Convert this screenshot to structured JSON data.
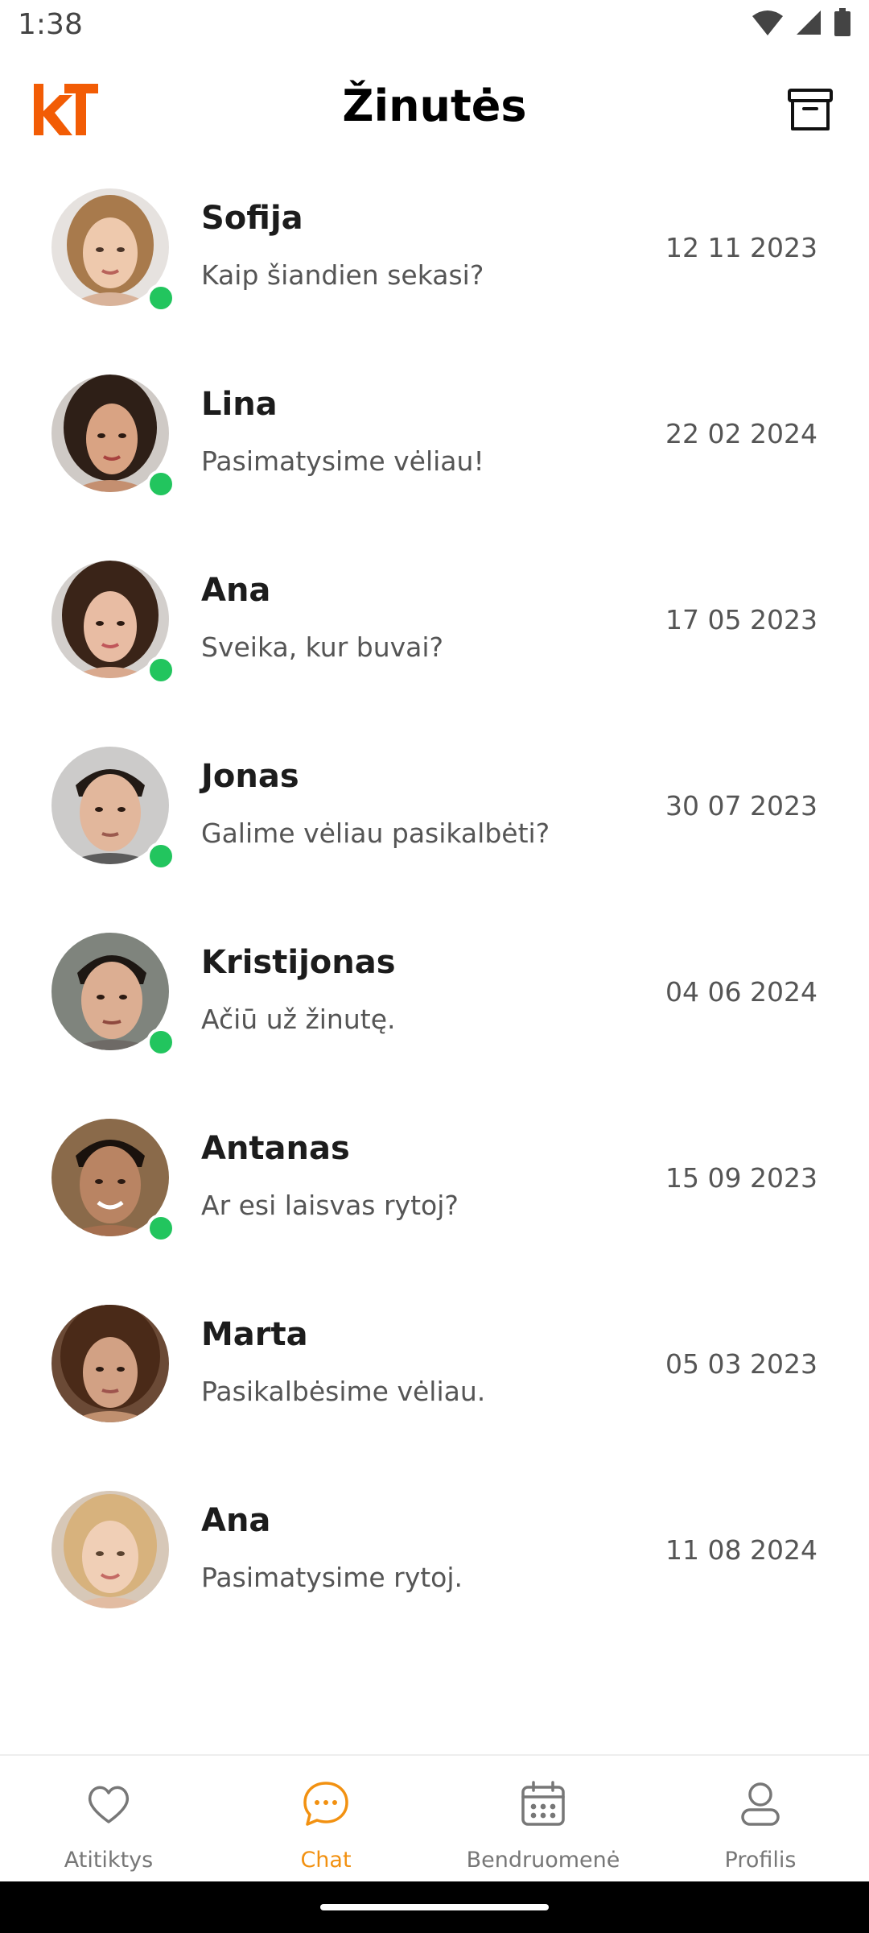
{
  "status_bar": {
    "time": "1:38"
  },
  "header": {
    "title": "Žinutės",
    "logo_text": "kT"
  },
  "conversations": [
    {
      "name": "Sofija",
      "preview": "Kaip šiandien sekasi?",
      "date": "12 11 2023",
      "online": true
    },
    {
      "name": "Lina",
      "preview": "Pasimatysime vėliau!",
      "date": "22 02 2024",
      "online": true
    },
    {
      "name": "Ana",
      "preview": "Sveika, kur buvai?",
      "date": "17 05 2023",
      "online": true
    },
    {
      "name": "Jonas",
      "preview": "Galime vėliau pasikalbėti?",
      "date": "30 07 2023",
      "online": true
    },
    {
      "name": "Kristijonas",
      "preview": "Ačiū už žinutę.",
      "date": "04 06 2024",
      "online": true
    },
    {
      "name": "Antanas",
      "preview": "Ar esi laisvas rytoj?",
      "date": "15 09 2023",
      "online": true
    },
    {
      "name": "Marta",
      "preview": "Pasikalbėsime vėliau.",
      "date": "05 03 2023",
      "online": false
    },
    {
      "name": "Ana",
      "preview": "Pasimatysime rytoj.",
      "date": "11 08 2024",
      "online": false
    }
  ],
  "bottom_nav": [
    {
      "label": "Atitiktys",
      "icon": "heart-icon",
      "active": false
    },
    {
      "label": "Chat",
      "icon": "chat-bubble-icon",
      "active": true
    },
    {
      "label": "Bendruomenė",
      "icon": "calendar-icon",
      "active": false
    },
    {
      "label": "Profilis",
      "icon": "user-icon",
      "active": false
    }
  ],
  "colors": {
    "accent": "#f29111",
    "online": "#22c55e",
    "logo": "#f25c05"
  }
}
